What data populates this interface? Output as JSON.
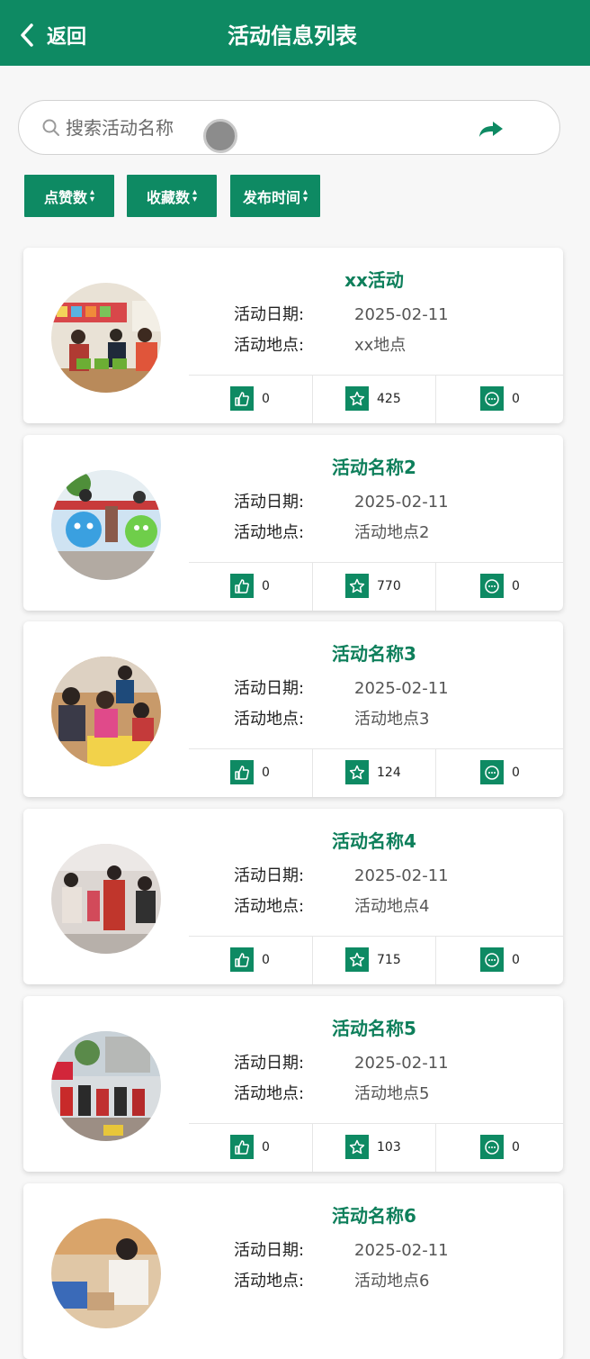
{
  "header": {
    "back_label": "返回",
    "title": "活动信息列表"
  },
  "search": {
    "placeholder": "搜索活动名称",
    "value": ""
  },
  "sort_buttons": [
    {
      "label": "点赞数"
    },
    {
      "label": "收藏数"
    },
    {
      "label": "发布时间"
    }
  ],
  "activities": [
    {
      "name": "xx活动",
      "date_label": "活动日期:",
      "date": "2025-02-11",
      "place_label": "活动地点:",
      "place": "xx地点",
      "likes": "0",
      "favorites": "425",
      "comments": "0"
    },
    {
      "name": "活动名称2",
      "date_label": "活动日期:",
      "date": "2025-02-11",
      "place_label": "活动地点:",
      "place": "活动地点2",
      "likes": "0",
      "favorites": "770",
      "comments": "0"
    },
    {
      "name": "活动名称3",
      "date_label": "活动日期:",
      "date": "2025-02-11",
      "place_label": "活动地点:",
      "place": "活动地点3",
      "likes": "0",
      "favorites": "124",
      "comments": "0"
    },
    {
      "name": "活动名称4",
      "date_label": "活动日期:",
      "date": "2025-02-11",
      "place_label": "活动地点:",
      "place": "活动地点4",
      "likes": "0",
      "favorites": "715",
      "comments": "0"
    },
    {
      "name": "活动名称5",
      "date_label": "活动日期:",
      "date": "2025-02-11",
      "place_label": "活动地点:",
      "place": "活动地点5",
      "likes": "0",
      "favorites": "103",
      "comments": "0"
    },
    {
      "name": "活动名称6",
      "date_label": "活动日期:",
      "date": "2025-02-11",
      "place_label": "活动地点:",
      "place": "活动地点6",
      "likes": "",
      "favorites": "",
      "comments": ""
    }
  ],
  "colors": {
    "brand": "#0e8a63",
    "brand_text": "#0e7f5b"
  },
  "icons": {
    "back": "chevron-left-icon",
    "search": "search-icon",
    "go": "share-arrow-icon",
    "like": "thumbs-up-icon",
    "favorite": "star-icon",
    "comment": "chat-bubble-icon"
  }
}
